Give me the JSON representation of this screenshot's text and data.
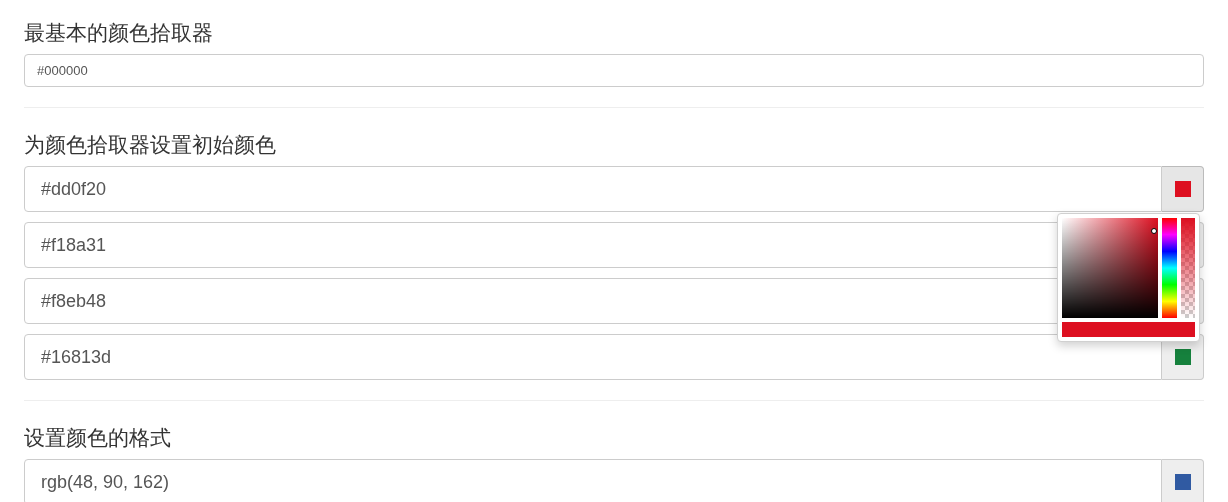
{
  "sections": [
    {
      "title": "最基本的颜色拾取器",
      "kind": "plain",
      "inputs": [
        {
          "value": "#000000"
        }
      ]
    },
    {
      "title": "为颜色拾取器设置初始颜色",
      "kind": "addon",
      "inputs": [
        {
          "value": "#dd0f20",
          "color": "#dd0f20",
          "picker_open": true
        },
        {
          "value": "#f18a31"
        },
        {
          "value": "#f8eb48"
        },
        {
          "value": "#16813d",
          "color": "#16813d"
        }
      ]
    },
    {
      "title": "设置颜色的格式",
      "kind": "addon",
      "inputs": [
        {
          "value": "rgb(48, 90, 162)",
          "color": "#305aa2"
        }
      ]
    }
  ]
}
